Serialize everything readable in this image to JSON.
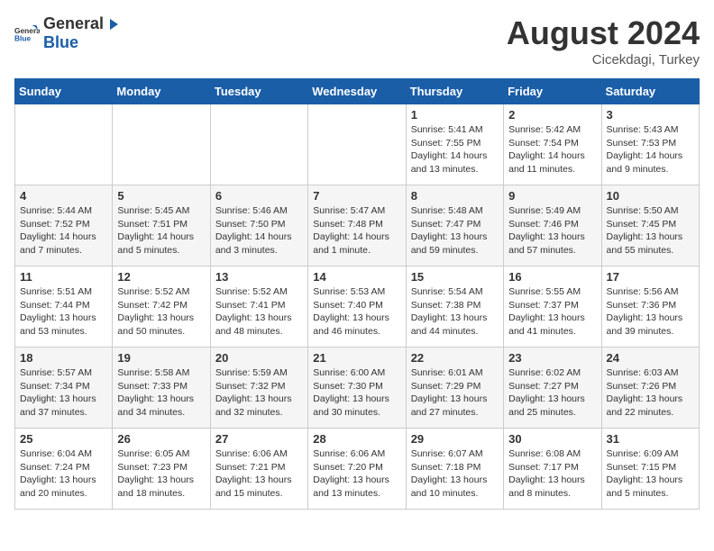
{
  "logo": {
    "text_general": "General",
    "text_blue": "Blue"
  },
  "title": "August 2024",
  "subtitle": "Cicekdagi, Turkey",
  "days_of_week": [
    "Sunday",
    "Monday",
    "Tuesday",
    "Wednesday",
    "Thursday",
    "Friday",
    "Saturday"
  ],
  "weeks": [
    [
      {
        "day": "",
        "detail": ""
      },
      {
        "day": "",
        "detail": ""
      },
      {
        "day": "",
        "detail": ""
      },
      {
        "day": "",
        "detail": ""
      },
      {
        "day": "1",
        "sunrise": "5:41 AM",
        "sunset": "7:55 PM",
        "daylight": "14 hours and 13 minutes."
      },
      {
        "day": "2",
        "sunrise": "5:42 AM",
        "sunset": "7:54 PM",
        "daylight": "14 hours and 11 minutes."
      },
      {
        "day": "3",
        "sunrise": "5:43 AM",
        "sunset": "7:53 PM",
        "daylight": "14 hours and 9 minutes."
      }
    ],
    [
      {
        "day": "4",
        "sunrise": "5:44 AM",
        "sunset": "7:52 PM",
        "daylight": "14 hours and 7 minutes."
      },
      {
        "day": "5",
        "sunrise": "5:45 AM",
        "sunset": "7:51 PM",
        "daylight": "14 hours and 5 minutes."
      },
      {
        "day": "6",
        "sunrise": "5:46 AM",
        "sunset": "7:50 PM",
        "daylight": "14 hours and 3 minutes."
      },
      {
        "day": "7",
        "sunrise": "5:47 AM",
        "sunset": "7:48 PM",
        "daylight": "14 hours and 1 minute."
      },
      {
        "day": "8",
        "sunrise": "5:48 AM",
        "sunset": "7:47 PM",
        "daylight": "13 hours and 59 minutes."
      },
      {
        "day": "9",
        "sunrise": "5:49 AM",
        "sunset": "7:46 PM",
        "daylight": "13 hours and 57 minutes."
      },
      {
        "day": "10",
        "sunrise": "5:50 AM",
        "sunset": "7:45 PM",
        "daylight": "13 hours and 55 minutes."
      }
    ],
    [
      {
        "day": "11",
        "sunrise": "5:51 AM",
        "sunset": "7:44 PM",
        "daylight": "13 hours and 53 minutes."
      },
      {
        "day": "12",
        "sunrise": "5:52 AM",
        "sunset": "7:42 PM",
        "daylight": "13 hours and 50 minutes."
      },
      {
        "day": "13",
        "sunrise": "5:52 AM",
        "sunset": "7:41 PM",
        "daylight": "13 hours and 48 minutes."
      },
      {
        "day": "14",
        "sunrise": "5:53 AM",
        "sunset": "7:40 PM",
        "daylight": "13 hours and 46 minutes."
      },
      {
        "day": "15",
        "sunrise": "5:54 AM",
        "sunset": "7:38 PM",
        "daylight": "13 hours and 44 minutes."
      },
      {
        "day": "16",
        "sunrise": "5:55 AM",
        "sunset": "7:37 PM",
        "daylight": "13 hours and 41 minutes."
      },
      {
        "day": "17",
        "sunrise": "5:56 AM",
        "sunset": "7:36 PM",
        "daylight": "13 hours and 39 minutes."
      }
    ],
    [
      {
        "day": "18",
        "sunrise": "5:57 AM",
        "sunset": "7:34 PM",
        "daylight": "13 hours and 37 minutes."
      },
      {
        "day": "19",
        "sunrise": "5:58 AM",
        "sunset": "7:33 PM",
        "daylight": "13 hours and 34 minutes."
      },
      {
        "day": "20",
        "sunrise": "5:59 AM",
        "sunset": "7:32 PM",
        "daylight": "13 hours and 32 minutes."
      },
      {
        "day": "21",
        "sunrise": "6:00 AM",
        "sunset": "7:30 PM",
        "daylight": "13 hours and 30 minutes."
      },
      {
        "day": "22",
        "sunrise": "6:01 AM",
        "sunset": "7:29 PM",
        "daylight": "13 hours and 27 minutes."
      },
      {
        "day": "23",
        "sunrise": "6:02 AM",
        "sunset": "7:27 PM",
        "daylight": "13 hours and 25 minutes."
      },
      {
        "day": "24",
        "sunrise": "6:03 AM",
        "sunset": "7:26 PM",
        "daylight": "13 hours and 22 minutes."
      }
    ],
    [
      {
        "day": "25",
        "sunrise": "6:04 AM",
        "sunset": "7:24 PM",
        "daylight": "13 hours and 20 minutes."
      },
      {
        "day": "26",
        "sunrise": "6:05 AM",
        "sunset": "7:23 PM",
        "daylight": "13 hours and 18 minutes."
      },
      {
        "day": "27",
        "sunrise": "6:06 AM",
        "sunset": "7:21 PM",
        "daylight": "13 hours and 15 minutes."
      },
      {
        "day": "28",
        "sunrise": "6:06 AM",
        "sunset": "7:20 PM",
        "daylight": "13 hours and 13 minutes."
      },
      {
        "day": "29",
        "sunrise": "6:07 AM",
        "sunset": "7:18 PM",
        "daylight": "13 hours and 10 minutes."
      },
      {
        "day": "30",
        "sunrise": "6:08 AM",
        "sunset": "7:17 PM",
        "daylight": "13 hours and 8 minutes."
      },
      {
        "day": "31",
        "sunrise": "6:09 AM",
        "sunset": "7:15 PM",
        "daylight": "13 hours and 5 minutes."
      }
    ]
  ]
}
